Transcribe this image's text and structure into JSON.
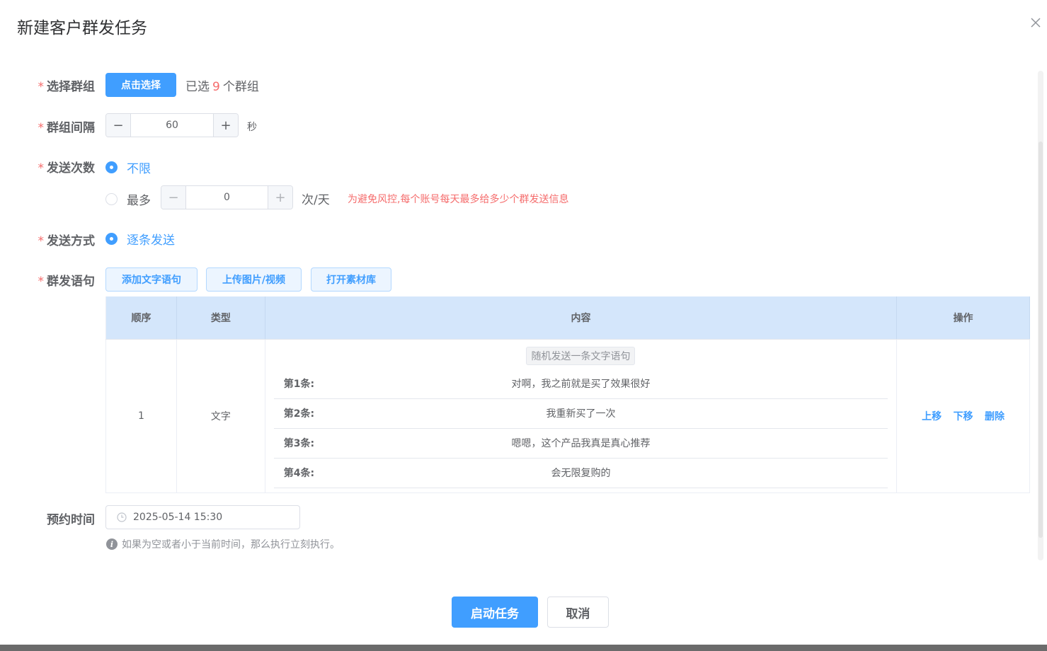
{
  "dialog": {
    "title": "新建客户群发任务"
  },
  "form": {
    "group": {
      "label": "选择群组",
      "button": "点击选择",
      "prefix": "已选",
      "count": "9",
      "suffix": "个群组"
    },
    "interval": {
      "label": "群组间隔",
      "value": "60",
      "unit": "秒",
      "dec": "−",
      "inc": "+"
    },
    "send_count": {
      "label": "发送次数",
      "option_unlimited": "不限",
      "option_max": "最多",
      "max_value": "0",
      "max_unit": "次/天",
      "dec": "−",
      "inc": "+",
      "warning": "为避免风控,每个账号每天最多给多少个群发送信息",
      "selected": "不限"
    },
    "send_mode": {
      "label": "发送方式",
      "option": "逐条发送",
      "selected": true
    },
    "messages": {
      "label": "群发语句",
      "buttons": {
        "add_text": "添加文字语句",
        "upload": "上传图片/视频",
        "library": "打开素材库"
      },
      "table": {
        "headers": {
          "order": "顺序",
          "type": "类型",
          "content": "内容",
          "ops": "操作"
        },
        "row": {
          "order": "1",
          "type": "文字",
          "tag": "随机发送一条文字语句",
          "lines": [
            {
              "no": "第1条:",
              "text": "对啊，我之前就是买了效果很好"
            },
            {
              "no": "第2条:",
              "text": "我重新买了一次"
            },
            {
              "no": "第3条:",
              "text": "嗯嗯，这个产品我真是真心推荐"
            },
            {
              "no": "第4条:",
              "text": "会无限复购的"
            }
          ],
          "ops": {
            "up": "上移",
            "down": "下移",
            "del": "删除"
          }
        }
      }
    },
    "schedule": {
      "label": "预约时间",
      "value": "2025-05-14 15:30",
      "hint": "如果为空或者小于当前时间，那么执行立刻执行。"
    }
  },
  "footer": {
    "start": "启动任务",
    "cancel": "取消"
  },
  "colors": {
    "primary": "#409eff",
    "danger": "#f56c6c",
    "header_bg": "#d4e6fb"
  }
}
